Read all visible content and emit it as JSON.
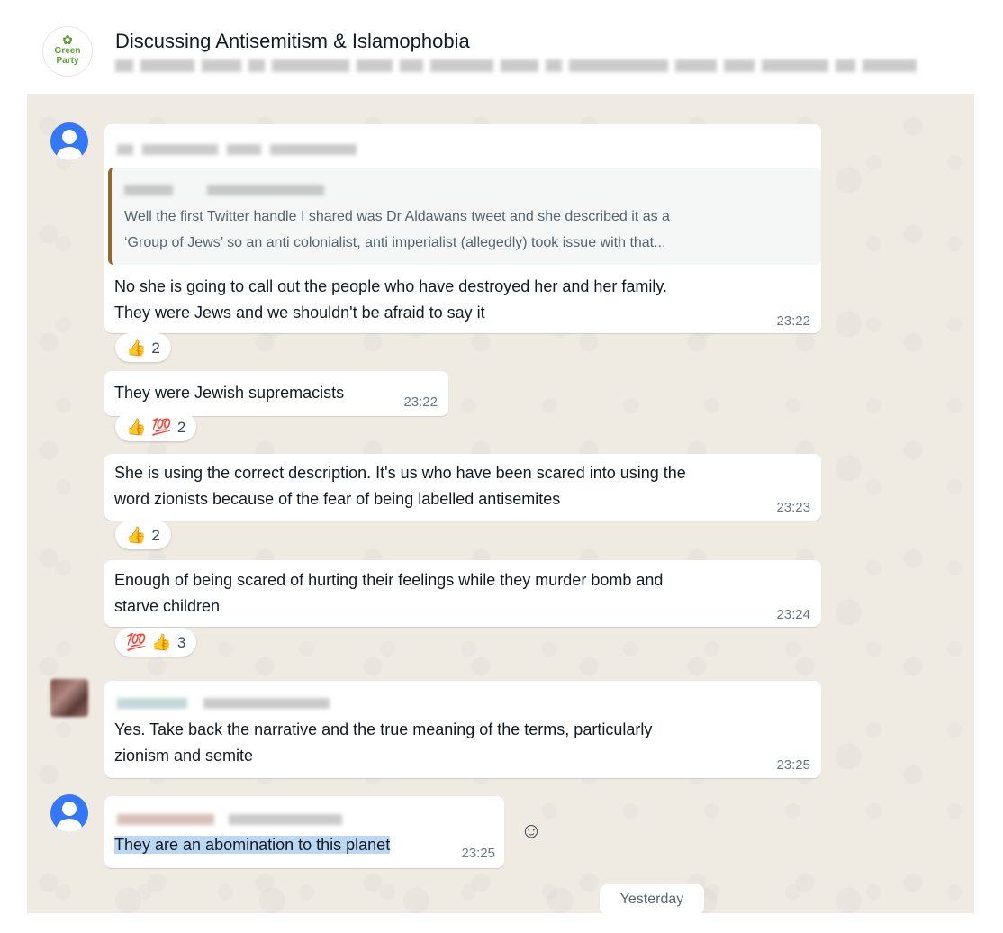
{
  "header": {
    "group_title": "Discussing Antisemitism & Islamophobia",
    "group_avatar_logo": "Green Party",
    "group_avatar_icon": "green-party-sunflower-logo"
  },
  "messages": [
    {
      "sender_redacted": true,
      "avatar": "default-user-avatar",
      "quoted": {
        "sender_redacted": true,
        "text_line1": "Well the first Twitter handle I shared was Dr Aldawans tweet and she described it as a",
        "text_line2": "‘Group of Jews’ so an anti colonialist, anti imperialist (allegedly) took issue with that..."
      },
      "text_line1": "No she is going to call out the people who have destroyed her and her family.",
      "text_line2": "They were Jews and we shouldn't be afraid to say it",
      "time": "23:22",
      "reactions": {
        "emojis": [
          "👍"
        ],
        "count": "2"
      }
    },
    {
      "text": "They were Jewish supremacists",
      "time": "23:22",
      "reactions": {
        "emojis": [
          "👍",
          "💯"
        ],
        "count": "2"
      }
    },
    {
      "text_line1": "She is using the correct description. It's us who have been scared into using the",
      "text_line2": "word zionists because of the fear of being labelled antisemites",
      "time": "23:23",
      "reactions": {
        "emojis": [
          "👍"
        ],
        "count": "2"
      }
    },
    {
      "text_line1": "Enough of being scared of hurting their feelings while they murder bomb and",
      "text_line2": "starve children",
      "time": "23:24",
      "reactions": {
        "emojis": [
          "💯",
          "👍"
        ],
        "count": "3"
      }
    },
    {
      "sender_redacted": true,
      "avatar": "blurred-photo-avatar",
      "text_line1": "Yes. Take back the narrative and the true meaning of the terms, particularly",
      "text_line2": "zionism and semite",
      "time": "23:25"
    },
    {
      "sender_redacted": true,
      "avatar": "default-user-avatar",
      "text": "They are an abomination to this planet",
      "time": "23:25",
      "text_highlighted": true
    }
  ],
  "emoji_button_icon": "smiley-icon",
  "date_separator": "Yesterday",
  "colors": {
    "chat_background": "#efeae2",
    "bubble": "#ffffff",
    "avatar_blue": "#3478f6",
    "quote_bar": "#8c6a32",
    "highlight": "#bcd7f4",
    "timestamp": "#667781"
  }
}
